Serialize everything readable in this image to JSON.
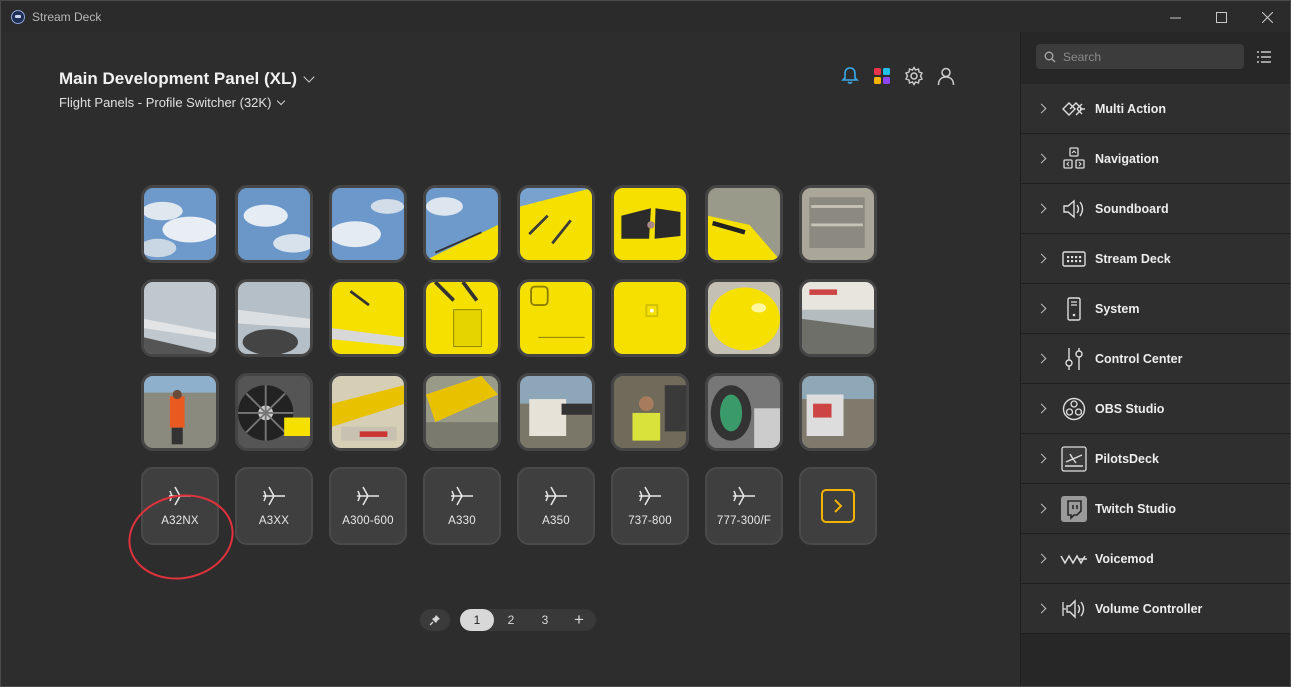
{
  "window": {
    "title": "Stream Deck"
  },
  "header": {
    "device_name": "Main Development Panel (XL)",
    "profile_name": "Flight Panels - Profile Switcher (32K)"
  },
  "keys": {
    "row4": [
      {
        "label": "A32NX",
        "icon": "airplane-icon"
      },
      {
        "label": "A3XX",
        "icon": "airplane-icon"
      },
      {
        "label": "A300-600",
        "icon": "airplane-icon"
      },
      {
        "label": "A330",
        "icon": "airplane-icon"
      },
      {
        "label": "A350",
        "icon": "airplane-icon"
      },
      {
        "label": "737-800",
        "icon": "airplane-icon"
      },
      {
        "label": "777-300/F",
        "icon": "airplane-icon"
      },
      {
        "label": "",
        "icon": "next-page-icon"
      }
    ]
  },
  "pager": {
    "pages": [
      "1",
      "2",
      "3"
    ],
    "active_page": "1",
    "add_label": "+"
  },
  "sidebar": {
    "search_placeholder": "Search",
    "categories": [
      {
        "label": "Multi Action",
        "icon": "multi-action-icon"
      },
      {
        "label": "Navigation",
        "icon": "navigation-icon"
      },
      {
        "label": "Soundboard",
        "icon": "speaker-icon"
      },
      {
        "label": "Stream Deck",
        "icon": "stream-deck-icon"
      },
      {
        "label": "System",
        "icon": "system-icon"
      },
      {
        "label": "Control Center",
        "icon": "sliders-icon"
      },
      {
        "label": "OBS Studio",
        "icon": "obs-icon"
      },
      {
        "label": "PilotsDeck",
        "icon": "pilotsdeck-icon"
      },
      {
        "label": "Twitch Studio",
        "icon": "twitch-icon"
      },
      {
        "label": "Voicemod",
        "icon": "voicemod-icon"
      },
      {
        "label": "Volume Controller",
        "icon": "volume-icon"
      }
    ]
  },
  "colors": {
    "accent_yellow": "#f2b400",
    "annotation_red": "#e0323c",
    "livery_yellow": "#f5e000"
  }
}
